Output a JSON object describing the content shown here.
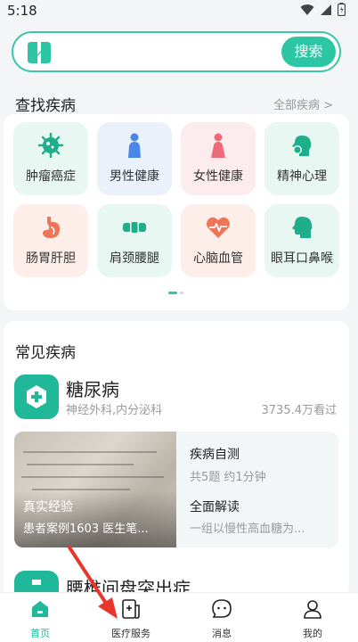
{
  "status_bar": {
    "time": "5:18"
  },
  "search": {
    "placeholder": "",
    "button_label": "搜索"
  },
  "find_diseases": {
    "title": "查找疾病",
    "see_all": "全部疾病 >",
    "categories": [
      {
        "label": "肿瘤癌症",
        "icon": "tumor-icon",
        "bg": "#e9f7f3",
        "color": "#1fae8c"
      },
      {
        "label": "男性健康",
        "icon": "male-icon",
        "bg": "#eaf1fb",
        "color": "#4a86e8"
      },
      {
        "label": "女性健康",
        "icon": "female-icon",
        "bg": "#fcecee",
        "color": "#ef6b7c"
      },
      {
        "label": "精神心理",
        "icon": "mental-icon",
        "bg": "#e9f7f3",
        "color": "#1fae8c"
      },
      {
        "label": "肠胃肝胆",
        "icon": "stomach-icon",
        "bg": "#fdeeea",
        "color": "#f07457"
      },
      {
        "label": "肩颈腰腿",
        "icon": "spine-icon",
        "bg": "#e9f7f3",
        "color": "#1fae8c"
      },
      {
        "label": "心脑血管",
        "icon": "heart-icon",
        "bg": "#fdeeea",
        "color": "#f07457"
      },
      {
        "label": "眼耳口鼻喉",
        "icon": "head-icon",
        "bg": "#e9f7f3",
        "color": "#1fae8c"
      }
    ]
  },
  "common_diseases": {
    "title": "常见疾病",
    "item1": {
      "name": "糖尿病",
      "departments": "神经外科,内分泌科",
      "views": "3735.4万看过",
      "experience_title": "真实经验",
      "experience_sub": "患者案例1603 医生笔...",
      "self_test_title": "疾病自测",
      "self_test_sub": "共5题 约1分钟",
      "analysis_title": "全面解读",
      "analysis_sub": "一组以慢性高血糖为..."
    },
    "item2": {
      "name": "腰椎间盘突出症"
    }
  },
  "tabs": [
    {
      "label": "首页",
      "icon": "home-icon",
      "active": true
    },
    {
      "label": "医疗服务",
      "icon": "medical-service-icon",
      "active": false
    },
    {
      "label": "消息",
      "icon": "message-icon",
      "active": false
    },
    {
      "label": "我的",
      "icon": "profile-icon",
      "active": false
    }
  ],
  "colors": {
    "accent": "#2cc6a4",
    "annotation_arrow": "#e8362d"
  }
}
